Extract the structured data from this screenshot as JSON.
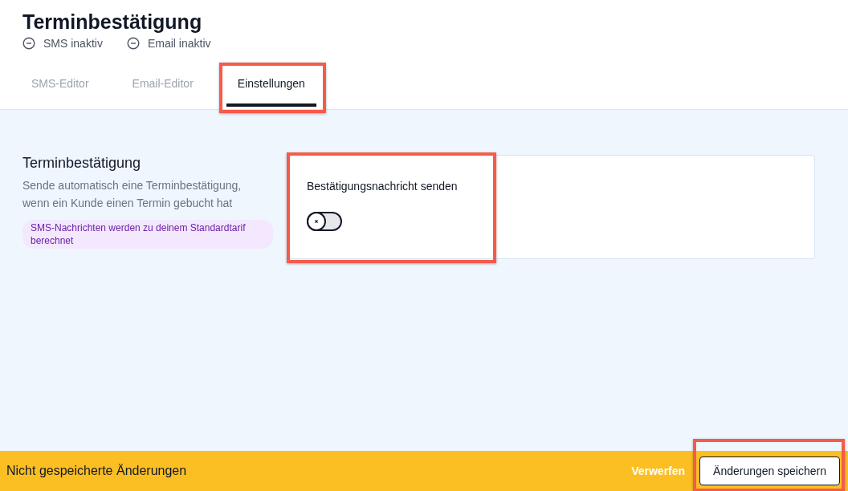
{
  "header": {
    "title": "Terminbestätigung",
    "channels": [
      {
        "label": "SMS inaktiv",
        "active": false
      },
      {
        "label": "Email inaktiv",
        "active": false
      }
    ]
  },
  "tabs": [
    {
      "label": "SMS-Editor",
      "selected": false,
      "highlighted": false
    },
    {
      "label": "Email-Editor",
      "selected": false,
      "highlighted": false
    },
    {
      "label": "Einstellungen",
      "selected": true,
      "highlighted": true
    }
  ],
  "section": {
    "title": "Terminbestätigung",
    "description": "Sende automatisch eine Terminbestätigung, wenn ein Kunde einen Termin gebucht hat",
    "notice": "SMS-Nachrichten werden zu deinem Standardtarif berechnet"
  },
  "setting": {
    "label": "Bestätigungsnachricht senden",
    "on": false,
    "highlighted": true
  },
  "footer": {
    "message": "Nicht gespeicherte Änderungen",
    "discard": "Verwerfen",
    "save": {
      "label": "Änderungen speichern",
      "highlighted": true
    }
  }
}
